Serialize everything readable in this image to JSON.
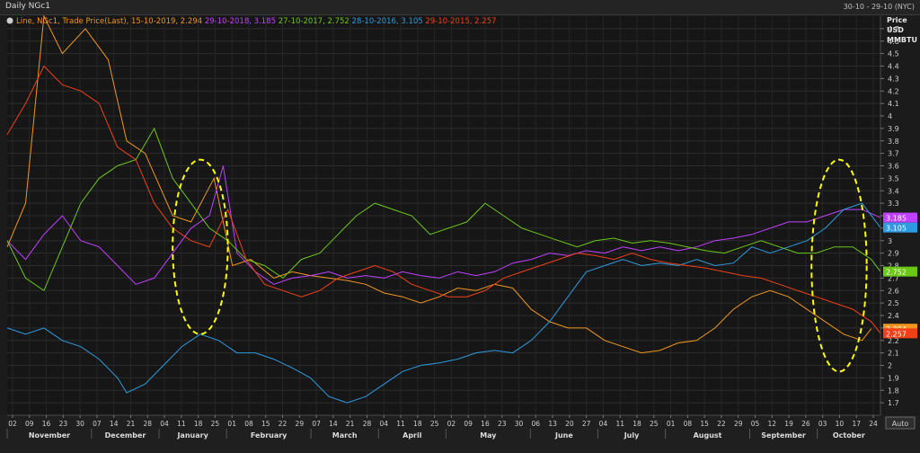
{
  "window": {
    "title": "Daily NGc1",
    "date_range": "30-10 - 29-10 (NYC)",
    "auto_button": "Auto"
  },
  "legend": {
    "prefix": "Line, NGc1, Trade Price(Last),",
    "entries": [
      {
        "text": "15-10-2019, 2.294",
        "color": "#f0961e"
      },
      {
        "text": "29-10-2018, 3.185",
        "color": "#c040ff"
      },
      {
        "text": "27-10-2017, 2.752",
        "color": "#6cc817"
      },
      {
        "text": "28-10-2016, 3.105",
        "color": "#2e9be0"
      },
      {
        "text": "29-10-2015, 2.257",
        "color": "#f04018"
      }
    ]
  },
  "chart_data": {
    "type": "line",
    "y_unit_label": [
      "Price",
      "USD",
      "MMBTU"
    ],
    "ylim": [
      1.6,
      4.8
    ],
    "y_ticks": [
      "1.7",
      "1.8",
      "1.9",
      "2",
      "2.1",
      "2.2",
      "2.3",
      "2.4",
      "2.5",
      "2.6",
      "2.7",
      "2.8",
      "2.9",
      "3",
      "3.1",
      "3.2",
      "3.3",
      "3.4",
      "3.5",
      "3.6",
      "3.7",
      "3.8",
      "3.9",
      "4",
      "4.1",
      "4.2",
      "4.3",
      "4.4",
      "4.5",
      "4.6",
      "4.7"
    ],
    "x_tick_labels": [
      "02",
      "09",
      "16",
      "23",
      "30",
      "07",
      "14",
      "21",
      "28",
      "04",
      "11",
      "18",
      "25",
      "01",
      "08",
      "15",
      "22",
      "29",
      "07",
      "14",
      "21",
      "28",
      "04",
      "11",
      "18",
      "25",
      "02",
      "09",
      "16",
      "23",
      "30",
      "06",
      "13",
      "20",
      "27",
      "04",
      "11",
      "18",
      "25",
      "01",
      "08",
      "15",
      "22",
      "29",
      "05",
      "12",
      "19",
      "26",
      "03",
      "10",
      "17",
      "24"
    ],
    "months": [
      "November",
      "December",
      "January",
      "February",
      "March",
      "April",
      "May",
      "June",
      "July",
      "August",
      "September",
      "October"
    ],
    "series": [
      {
        "name": "15-10-2019",
        "color": "#f0961e",
        "last": "2.294",
        "points": [
          [
            0,
            2.95
          ],
          [
            4,
            3.3
          ],
          [
            8,
            4.8
          ],
          [
            12,
            4.5
          ],
          [
            17,
            4.7
          ],
          [
            22,
            4.45
          ],
          [
            26,
            3.8
          ],
          [
            30,
            3.7
          ],
          [
            36,
            3.2
          ],
          [
            40,
            3.15
          ],
          [
            45,
            3.5
          ],
          [
            49,
            2.8
          ],
          [
            53,
            2.85
          ],
          [
            58,
            2.7
          ],
          [
            62,
            2.75
          ],
          [
            66,
            2.72
          ],
          [
            70,
            2.7
          ],
          [
            74,
            2.68
          ],
          [
            78,
            2.65
          ],
          [
            82,
            2.58
          ],
          [
            86,
            2.55
          ],
          [
            90,
            2.5
          ],
          [
            94,
            2.55
          ],
          [
            98,
            2.62
          ],
          [
            102,
            2.6
          ],
          [
            106,
            2.65
          ],
          [
            110,
            2.62
          ],
          [
            114,
            2.45
          ],
          [
            118,
            2.35
          ],
          [
            122,
            2.3
          ],
          [
            126,
            2.3
          ],
          [
            130,
            2.2
          ],
          [
            134,
            2.15
          ],
          [
            138,
            2.1
          ],
          [
            142,
            2.12
          ],
          [
            146,
            2.18
          ],
          [
            150,
            2.2
          ],
          [
            154,
            2.3
          ],
          [
            158,
            2.45
          ],
          [
            162,
            2.55
          ],
          [
            166,
            2.6
          ],
          [
            170,
            2.55
          ],
          [
            174,
            2.45
          ],
          [
            178,
            2.35
          ],
          [
            182,
            2.25
          ],
          [
            186,
            2.2
          ],
          [
            188,
            2.294
          ]
        ]
      },
      {
        "name": "29-10-2018",
        "color": "#c040ff",
        "last": "3.185",
        "points": [
          [
            0,
            3.0
          ],
          [
            4,
            2.85
          ],
          [
            8,
            3.05
          ],
          [
            12,
            3.2
          ],
          [
            16,
            3.0
          ],
          [
            20,
            2.95
          ],
          [
            24,
            2.8
          ],
          [
            28,
            2.65
          ],
          [
            32,
            2.7
          ],
          [
            36,
            2.9
          ],
          [
            40,
            3.1
          ],
          [
            44,
            3.2
          ],
          [
            47,
            3.6
          ],
          [
            50,
            2.9
          ],
          [
            54,
            2.75
          ],
          [
            58,
            2.65
          ],
          [
            62,
            2.7
          ],
          [
            66,
            2.72
          ],
          [
            70,
            2.75
          ],
          [
            74,
            2.7
          ],
          [
            78,
            2.72
          ],
          [
            82,
            2.7
          ],
          [
            86,
            2.75
          ],
          [
            90,
            2.72
          ],
          [
            94,
            2.7
          ],
          [
            98,
            2.75
          ],
          [
            102,
            2.72
          ],
          [
            106,
            2.75
          ],
          [
            110,
            2.82
          ],
          [
            114,
            2.85
          ],
          [
            118,
            2.9
          ],
          [
            122,
            2.88
          ],
          [
            126,
            2.92
          ],
          [
            130,
            2.9
          ],
          [
            134,
            2.95
          ],
          [
            138,
            2.92
          ],
          [
            142,
            2.95
          ],
          [
            146,
            2.92
          ],
          [
            150,
            2.95
          ],
          [
            154,
            3.0
          ],
          [
            158,
            3.02
          ],
          [
            162,
            3.05
          ],
          [
            166,
            3.1
          ],
          [
            170,
            3.15
          ],
          [
            174,
            3.15
          ],
          [
            178,
            3.2
          ],
          [
            182,
            3.25
          ],
          [
            186,
            3.25
          ],
          [
            190,
            3.185
          ]
        ]
      },
      {
        "name": "27-10-2017",
        "color": "#6cc817",
        "last": "2.752",
        "points": [
          [
            0,
            3.0
          ],
          [
            4,
            2.7
          ],
          [
            8,
            2.6
          ],
          [
            12,
            2.95
          ],
          [
            16,
            3.3
          ],
          [
            20,
            3.5
          ],
          [
            24,
            3.6
          ],
          [
            28,
            3.65
          ],
          [
            32,
            3.9
          ],
          [
            36,
            3.5
          ],
          [
            40,
            3.3
          ],
          [
            44,
            3.1
          ],
          [
            48,
            3.0
          ],
          [
            52,
            2.85
          ],
          [
            56,
            2.8
          ],
          [
            60,
            2.7
          ],
          [
            64,
            2.85
          ],
          [
            68,
            2.9
          ],
          [
            72,
            3.05
          ],
          [
            76,
            3.2
          ],
          [
            80,
            3.3
          ],
          [
            84,
            3.25
          ],
          [
            88,
            3.2
          ],
          [
            92,
            3.05
          ],
          [
            96,
            3.1
          ],
          [
            100,
            3.15
          ],
          [
            104,
            3.3
          ],
          [
            108,
            3.2
          ],
          [
            112,
            3.1
          ],
          [
            116,
            3.05
          ],
          [
            120,
            3.0
          ],
          [
            124,
            2.95
          ],
          [
            128,
            3.0
          ],
          [
            132,
            3.02
          ],
          [
            136,
            2.98
          ],
          [
            140,
            3.0
          ],
          [
            144,
            2.98
          ],
          [
            148,
            2.95
          ],
          [
            152,
            2.92
          ],
          [
            156,
            2.9
          ],
          [
            160,
            2.95
          ],
          [
            164,
            3.0
          ],
          [
            168,
            2.95
          ],
          [
            172,
            2.9
          ],
          [
            176,
            2.9
          ],
          [
            180,
            2.95
          ],
          [
            184,
            2.95
          ],
          [
            188,
            2.85
          ],
          [
            190,
            2.752
          ]
        ]
      },
      {
        "name": "28-10-2016",
        "color": "#2e9be0",
        "last": "3.105",
        "points": [
          [
            0,
            2.3
          ],
          [
            4,
            2.25
          ],
          [
            8,
            2.3
          ],
          [
            12,
            2.2
          ],
          [
            16,
            2.15
          ],
          [
            20,
            2.05
          ],
          [
            24,
            1.9
          ],
          [
            26,
            1.78
          ],
          [
            30,
            1.85
          ],
          [
            34,
            2.0
          ],
          [
            38,
            2.15
          ],
          [
            42,
            2.25
          ],
          [
            46,
            2.2
          ],
          [
            50,
            2.1
          ],
          [
            54,
            2.1
          ],
          [
            58,
            2.05
          ],
          [
            62,
            1.98
          ],
          [
            66,
            1.9
          ],
          [
            70,
            1.75
          ],
          [
            74,
            1.7
          ],
          [
            78,
            1.75
          ],
          [
            82,
            1.85
          ],
          [
            86,
            1.95
          ],
          [
            90,
            2.0
          ],
          [
            94,
            2.02
          ],
          [
            98,
            2.05
          ],
          [
            102,
            2.1
          ],
          [
            106,
            2.12
          ],
          [
            110,
            2.1
          ],
          [
            114,
            2.2
          ],
          [
            118,
            2.35
          ],
          [
            122,
            2.55
          ],
          [
            126,
            2.75
          ],
          [
            130,
            2.8
          ],
          [
            134,
            2.85
          ],
          [
            138,
            2.8
          ],
          [
            142,
            2.82
          ],
          [
            146,
            2.8
          ],
          [
            150,
            2.85
          ],
          [
            154,
            2.8
          ],
          [
            158,
            2.82
          ],
          [
            162,
            2.95
          ],
          [
            166,
            2.9
          ],
          [
            170,
            2.95
          ],
          [
            174,
            3.0
          ],
          [
            178,
            3.1
          ],
          [
            182,
            3.25
          ],
          [
            186,
            3.3
          ],
          [
            190,
            3.105
          ]
        ]
      },
      {
        "name": "29-10-2015",
        "color": "#f04018",
        "last": "2.257",
        "points": [
          [
            0,
            3.85
          ],
          [
            4,
            4.1
          ],
          [
            8,
            4.4
          ],
          [
            12,
            4.25
          ],
          [
            16,
            4.2
          ],
          [
            20,
            4.1
          ],
          [
            24,
            3.75
          ],
          [
            28,
            3.65
          ],
          [
            32,
            3.3
          ],
          [
            36,
            3.1
          ],
          [
            40,
            3.0
          ],
          [
            44,
            2.95
          ],
          [
            48,
            3.25
          ],
          [
            52,
            2.85
          ],
          [
            56,
            2.65
          ],
          [
            60,
            2.6
          ],
          [
            64,
            2.55
          ],
          [
            68,
            2.6
          ],
          [
            72,
            2.7
          ],
          [
            76,
            2.75
          ],
          [
            80,
            2.8
          ],
          [
            84,
            2.75
          ],
          [
            88,
            2.65
          ],
          [
            92,
            2.6
          ],
          [
            96,
            2.55
          ],
          [
            100,
            2.55
          ],
          [
            104,
            2.6
          ],
          [
            108,
            2.7
          ],
          [
            112,
            2.75
          ],
          [
            116,
            2.8
          ],
          [
            120,
            2.85
          ],
          [
            124,
            2.9
          ],
          [
            128,
            2.88
          ],
          [
            132,
            2.85
          ],
          [
            136,
            2.9
          ],
          [
            140,
            2.85
          ],
          [
            144,
            2.82
          ],
          [
            148,
            2.8
          ],
          [
            152,
            2.78
          ],
          [
            156,
            2.75
          ],
          [
            160,
            2.72
          ],
          [
            164,
            2.7
          ],
          [
            168,
            2.65
          ],
          [
            172,
            2.6
          ],
          [
            176,
            2.55
          ],
          [
            180,
            2.5
          ],
          [
            184,
            2.45
          ],
          [
            188,
            2.35
          ],
          [
            190,
            2.257
          ]
        ]
      }
    ],
    "x_domain": [
      0,
      190
    ],
    "annotations": [
      {
        "shape": "dashed-ellipse",
        "color": "#ffff00",
        "cx": 42,
        "cy": 2.95,
        "rx": 6,
        "ry": 0.7
      },
      {
        "shape": "dashed-ellipse",
        "color": "#ffff00",
        "cx": 181,
        "cy": 2.8,
        "rx": 6,
        "ry": 0.85
      }
    ]
  }
}
